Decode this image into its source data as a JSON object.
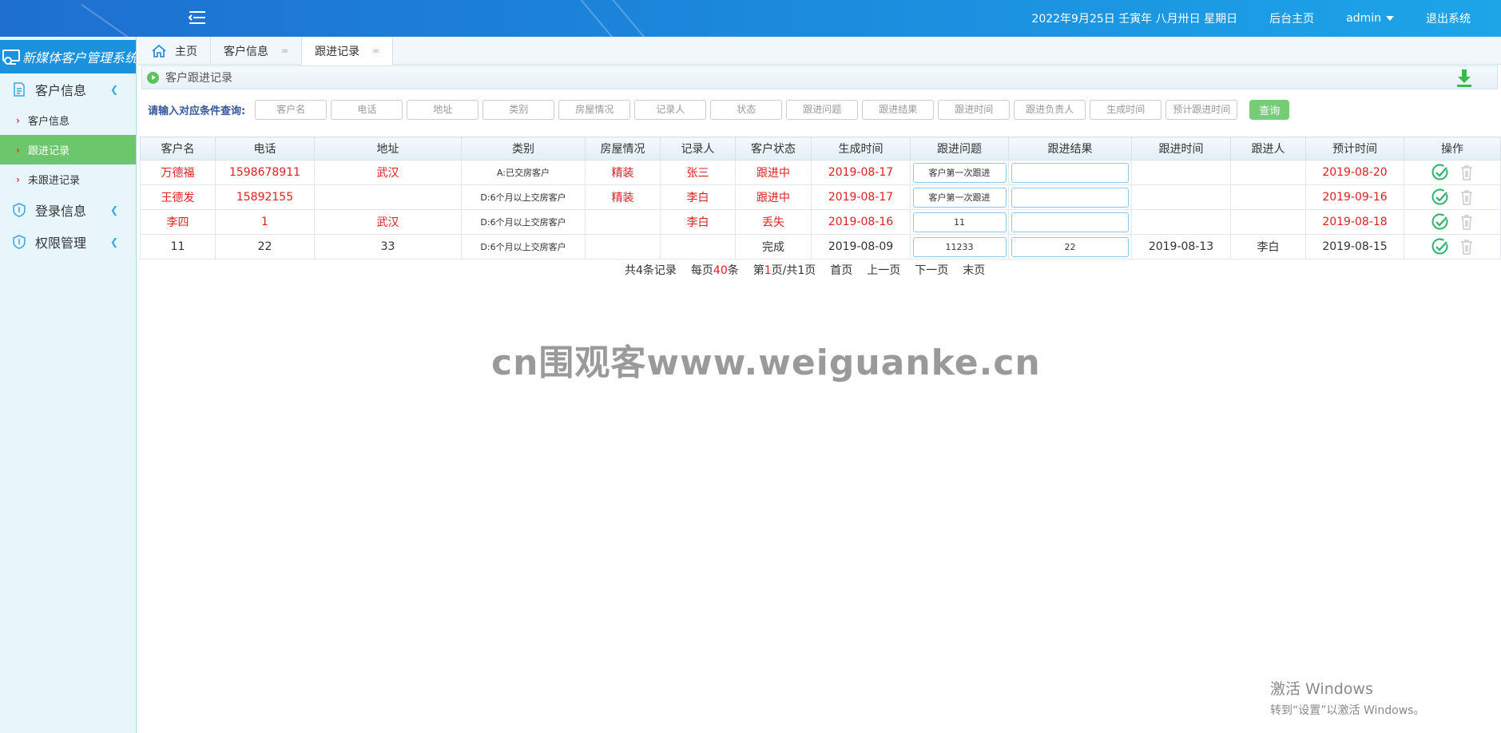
{
  "header": {
    "date": "2022年9月25日 壬寅年 八月卅日 星期日",
    "home_link": "后台主页",
    "user": "admin",
    "logout": "退出系统"
  },
  "sidebar": {
    "brand": "新媒体客户管理系统",
    "groups": [
      {
        "label": "客户信息",
        "icon": "document-icon",
        "items": [
          {
            "label": "客户信息"
          },
          {
            "label": "跟进记录",
            "active": true
          },
          {
            "label": "未跟进记录"
          }
        ]
      },
      {
        "label": "登录信息",
        "icon": "shield-icon"
      },
      {
        "label": "权限管理",
        "icon": "shield-icon"
      }
    ]
  },
  "tabs": [
    {
      "label": "主页",
      "icon": "home-icon"
    },
    {
      "label": "客户信息"
    },
    {
      "label": "跟进记录",
      "active": true
    }
  ],
  "panel": {
    "title": "客户跟进记录"
  },
  "search": {
    "label": "请输入对应条件查询:",
    "placeholders": [
      "客户名",
      "电话",
      "地址",
      "类别",
      "房屋情况",
      "记录人",
      "状态",
      "跟进问题",
      "跟进结果",
      "跟进时间",
      "跟进负责人",
      "生成时间",
      "预计跟进时间"
    ],
    "button": "查询"
  },
  "table": {
    "columns": [
      "客户名",
      "电话",
      "地址",
      "类别",
      "房屋情况",
      "记录人",
      "客户状态",
      "生成时间",
      "跟进问题",
      "跟进结果",
      "跟进时间",
      "跟进人",
      "预计时间",
      "操作"
    ],
    "rows": [
      {
        "name": "万德福",
        "phone": "1598678911",
        "address": "武汉",
        "category": "A:已交房客户",
        "house": "精装",
        "recorder": "张三",
        "status": "跟进中",
        "created": "2019-08-17",
        "question": "客户第一次跟进",
        "result": "",
        "follow_time": "",
        "follower": "",
        "expected": "2019-08-20",
        "highlight": true
      },
      {
        "name": "王德发",
        "phone": "15892155",
        "address": "",
        "category": "D:6个月以上交房客户",
        "house": "精装",
        "recorder": "李白",
        "status": "跟进中",
        "created": "2019-08-17",
        "question": "客户第一次跟进",
        "result": "",
        "follow_time": "",
        "follower": "",
        "expected": "2019-09-16",
        "highlight": true
      },
      {
        "name": "李四",
        "phone": "1",
        "address": "武汉",
        "category": "D:6个月以上交房客户",
        "house": "",
        "recorder": "李白",
        "status": "丢失",
        "created": "2019-08-16",
        "question": "11",
        "result": "",
        "follow_time": "",
        "follower": "",
        "expected": "2019-08-18",
        "highlight": true
      },
      {
        "name": "11",
        "phone": "22",
        "address": "33",
        "category": "D:6个月以上交房客户",
        "house": "",
        "recorder": "",
        "status": "完成",
        "created": "2019-08-09",
        "question": "11233",
        "result": "22",
        "follow_time": "2019-08-13",
        "follower": "李白",
        "expected": "2019-08-15",
        "highlight": false
      }
    ]
  },
  "pager": {
    "total_prefix": "共",
    "total": "4",
    "total_suffix": "条记录",
    "per_page_prefix": "每页",
    "per_page": "40",
    "per_page_suffix": "条",
    "page_prefix": "第",
    "page": "1",
    "page_suffix": "页/共1页",
    "first": "首页",
    "prev": "上一页",
    "next": "下一页",
    "last": "末页"
  },
  "watermark": "cn围观客www.weiguanke.cn",
  "windows_activation": {
    "line1": "激活 Windows",
    "line2": "转到“设置”以激活 Windows。"
  },
  "colors": {
    "accent": "#1a86db",
    "active_green": "#6cc66c",
    "highlight_red": "#e02020"
  }
}
